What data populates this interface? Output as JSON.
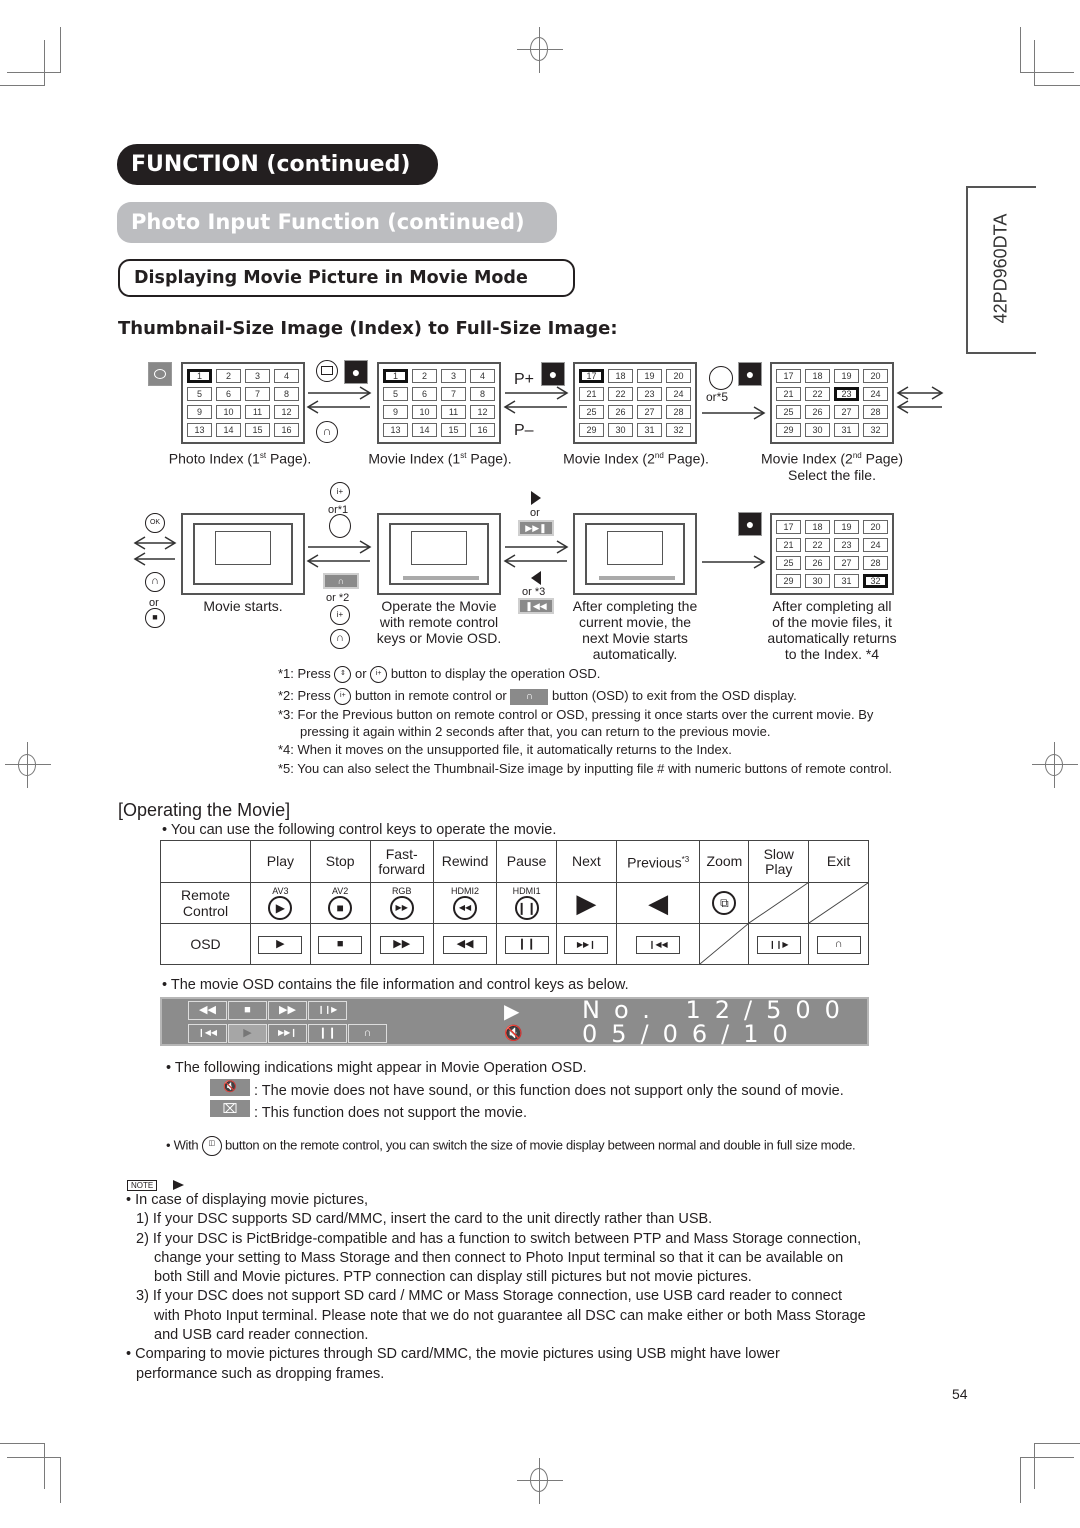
{
  "header": {
    "section": "FUNCTION (continued)",
    "subsection": "Photo Input Function (continued)",
    "topic": "Displaying Movie Picture in Movie Mode",
    "heading": "Thumbnail-Size Image (Index) to Full-Size Image:",
    "model": "42PD960DTA"
  },
  "diagram": {
    "grids": [
      {
        "caption": "Photo Index (1",
        "sup": "st",
        "caption_end": " Page).",
        "cells": [
          "1",
          "2",
          "3",
          "4",
          "5",
          "6",
          "7",
          "8",
          "9",
          "10",
          "11",
          "12",
          "13",
          "14",
          "15",
          "16"
        ],
        "selected": "1"
      },
      {
        "caption": "Movie Index (1",
        "sup": "st",
        "caption_end": " Page).",
        "cells": [
          "1",
          "2",
          "3",
          "4",
          "5",
          "6",
          "7",
          "8",
          "9",
          "10",
          "11",
          "12",
          "13",
          "14",
          "15",
          "16"
        ],
        "selected": "1"
      },
      {
        "caption": "Movie Index (2",
        "sup": "nd",
        "caption_end": " Page).",
        "cells": [
          "17",
          "18",
          "19",
          "20",
          "21",
          "22",
          "23",
          "24",
          "25",
          "26",
          "27",
          "28",
          "29",
          "30",
          "31",
          "32"
        ],
        "selected": "17"
      },
      {
        "caption": "Movie Index (2",
        "sup": "nd",
        "caption_end": " Page)",
        "caption2": "Select the file.",
        "cells": [
          "17",
          "18",
          "19",
          "20",
          "21",
          "22",
          "23",
          "24",
          "25",
          "26",
          "27",
          "28",
          "29",
          "30",
          "31",
          "32"
        ],
        "selected": "23"
      },
      {
        "caption": "After completing all",
        "caption2": "of the movie files, it",
        "caption3": "automatically returns",
        "caption4": "to the Index. *4",
        "cells": [
          "17",
          "18",
          "19",
          "20",
          "21",
          "22",
          "23",
          "24",
          "25",
          "26",
          "27",
          "28",
          "29",
          "30",
          "31",
          "32"
        ],
        "selected": "32"
      }
    ],
    "p_plus": "P+",
    "p_minus": "P–",
    "or5": "or*5",
    "or1": "or*1",
    "or2": "or *2",
    "or3": "or *3",
    "or": "or",
    "ok": "OK",
    "movie_starts": "Movie starts.",
    "operate": [
      "Operate the Movie",
      "with remote control",
      "keys or Movie OSD."
    ],
    "after_current": [
      "After completing the",
      "current movie, the",
      "next Movie starts",
      "automatically."
    ]
  },
  "footnotes": {
    "n1_a": "*1: Press",
    "n1_b": "or",
    "n1_c": "button to display the operation OSD.",
    "n2_a": "*2: Press",
    "n2_b": "button in remote control or",
    "n2_c": "button (OSD) to exit from the OSD display.",
    "n3": "*3: For the Previous button on remote control or OSD, pressing it once starts over the current movie. By",
    "n3b": "pressing it again within 2 seconds after that, you can return to the previous movie.",
    "n4": "*4: When it moves on the unsupported file, it automatically returns to the Index.",
    "n5": "*5: You can also select the Thumbnail-Size image by inputting file # with numeric buttons of remote control."
  },
  "operating": {
    "title": "[Operating the Movie]",
    "intro": "• You can use the following control keys to operate the movie.",
    "columns": [
      "Play",
      "Stop",
      "Fast-\nforward",
      "Rewind",
      "Pause",
      "Next",
      "Previous",
      "Zoom",
      "Slow\nPlay",
      "Exit"
    ],
    "previous_sup": "*3",
    "row_remote": "Remote\nControl",
    "row_osd": "OSD",
    "remote_labels": [
      "AV3",
      "AV2",
      "RGB",
      "HDMI2",
      "HDMI1",
      "",
      "",
      "",
      "",
      ""
    ],
    "remote_icons": [
      "▶",
      "■",
      "▶▶",
      "◀◀",
      "❙❙",
      "▶",
      "◀",
      "⧉",
      "",
      ""
    ],
    "osd_icons": [
      "▶",
      "■",
      "▶▶",
      "◀◀",
      "❙❙",
      "▶▶❙",
      "❙◀◀",
      "",
      "❙❙▶",
      "∩"
    ]
  },
  "osd_panel": {
    "intro": "• The movie OSD contains the file information and control keys as below.",
    "row1_keys": [
      "◀◀",
      "■",
      "▶▶",
      "❙❙▶"
    ],
    "row2_keys": [
      "❙◀◀",
      "▶",
      "▶▶❙",
      "❙❙",
      "∩"
    ],
    "status_play": "▶",
    "file_no": "No. 12∕500",
    "date": "05∕06∕10"
  },
  "indications": {
    "intro": "• The following indications might appear in Movie Operation OSD.",
    "mute_text": ": The movie does not have sound, or this function does not support only the sound of movie.",
    "unsupported_text": ": This function does not support the movie.",
    "with_a": "• With",
    "with_b": "button on the remote control, you can switch the size of movie display between normal and double in full size mode."
  },
  "note": {
    "label": "NOTE",
    "lines": [
      {
        "cls": "i0",
        "text": "• In case of displaying movie pictures,"
      },
      {
        "cls": "i1",
        "text": "1) If your DSC supports SD card/MMC, insert the card to the unit directly rather than USB."
      },
      {
        "cls": "i1",
        "text": "2) If your DSC is PictBridge-compatible and has a function to switch between PTP and Mass Storage connection,"
      },
      {
        "cls": "i2",
        "text": "change your setting to Mass Storage and then connect to Photo Input terminal so that it can be available on"
      },
      {
        "cls": "i2",
        "text": "both Still and Movie pictures. PTP connection can display still pictures but not movie pictures."
      },
      {
        "cls": "i1",
        "text": "3) If your DSC does not support SD card / MMC or Mass Storage connection, use USB card reader to connect"
      },
      {
        "cls": "i2",
        "text": "with Photo Input terminal. Please note that we do not guarantee all DSC can make either or both Mass Storage"
      },
      {
        "cls": "i2",
        "text": "and USB card reader connection."
      },
      {
        "cls": "i0",
        "text": "• Comparing to movie pictures through SD card/MMC, the movie pictures using USB might have lower"
      },
      {
        "cls": "i1",
        "text": "performance such as dropping frames."
      }
    ]
  },
  "page_number": "54"
}
